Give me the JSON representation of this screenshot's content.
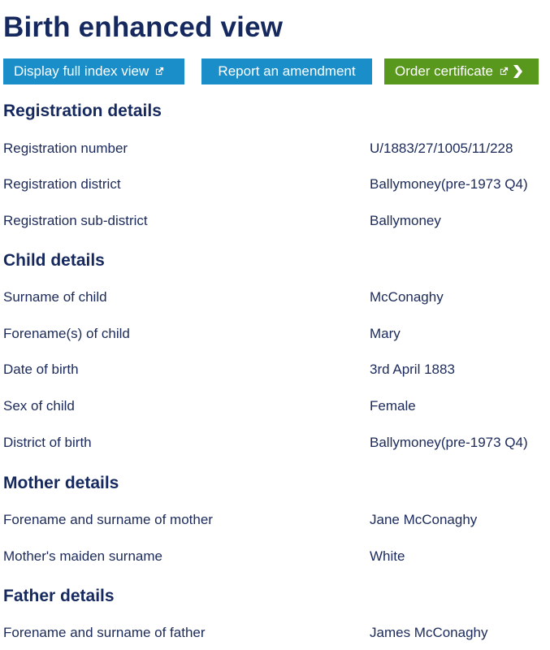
{
  "page": {
    "title": "Birth enhanced view"
  },
  "buttons": {
    "full_index": "Display full index view",
    "amendment": "Report an amendment",
    "order": "Order certificate"
  },
  "icons": {
    "external_link": "external-link-icon",
    "chevron": "chevron-right-icon"
  },
  "colors": {
    "heading": "#16295e",
    "button_blue": "#1a8ec9",
    "button_green": "#58981c",
    "text": "#1b2a5a"
  },
  "sections": [
    {
      "heading": "Registration details",
      "rows": [
        {
          "label": "Registration number",
          "value": "U/1883/27/1005/11/228"
        },
        {
          "label": "Registration district",
          "value": "Ballymoney(pre-1973 Q4)"
        },
        {
          "label": "Registration sub-district",
          "value": "Ballymoney"
        }
      ]
    },
    {
      "heading": "Child details",
      "rows": [
        {
          "label": "Surname of child",
          "value": "McConaghy"
        },
        {
          "label": "Forename(s) of child",
          "value": "Mary"
        },
        {
          "label": "Date of birth",
          "value": "3rd April 1883"
        },
        {
          "label": "Sex of child",
          "value": "Female"
        },
        {
          "label": "District of birth",
          "value": "Ballymoney(pre-1973 Q4)"
        }
      ]
    },
    {
      "heading": "Mother details",
      "rows": [
        {
          "label": "Forename and surname of mother",
          "value": "Jane McConaghy"
        },
        {
          "label": "Mother's maiden surname",
          "value": "White"
        }
      ]
    },
    {
      "heading": "Father details",
      "rows": [
        {
          "label": "Forename and surname of father",
          "value": "James McConaghy"
        }
      ]
    }
  ]
}
